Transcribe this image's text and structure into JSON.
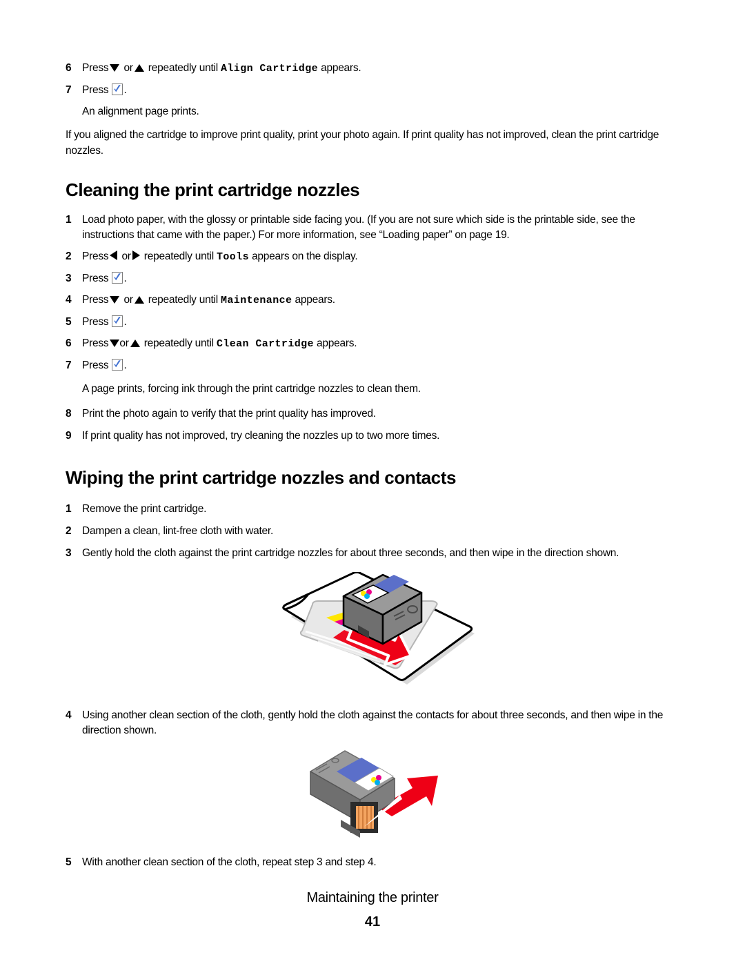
{
  "document": {
    "type": "printer-user-guide-page",
    "page_number": "41",
    "footer_title": "Maintaining the printer"
  },
  "top_steps": [
    {
      "num": "6",
      "pre": "Press",
      "icon_a": "triangle-down-icon",
      "mid": "or",
      "icon_b": "triangle-up-icon",
      "after": "repeatedly until",
      "mono": "Align Cartridge",
      "tail": "appears."
    },
    {
      "num": "7",
      "pre": "Press",
      "icon_a": "check-select-icon",
      "tail": "."
    }
  ],
  "top_result": "An alignment page prints.",
  "intro_paragraph": "If you aligned the cartridge to improve print quality, print your photo again. If print quality has not improved, clean the print cartridge nozzles.",
  "section_cleaning": {
    "heading": "Cleaning the print cartridge nozzles",
    "steps": [
      {
        "num": "1",
        "text": "Load photo paper, with the glossy or printable side facing you. (If you are not sure which side is the printable side, see the instructions that came with the paper.) For more information, see “Loading paper” on page 19."
      },
      {
        "num": "2",
        "pre": "Press",
        "icon_a": "triangle-left-icon",
        "mid": "or",
        "icon_b": "triangle-right-icon",
        "after": "repeatedly until",
        "mono": "Tools",
        "tail": "appears on the display."
      },
      {
        "num": "3",
        "pre": "Press",
        "icon_a": "check-select-icon",
        "tail": "."
      },
      {
        "num": "4",
        "pre": "Press",
        "icon_a": "triangle-down-icon",
        "mid": "or",
        "icon_b": "triangle-up-icon",
        "after": "repeatedly until",
        "mono": "Maintenance",
        "tail": "appears."
      },
      {
        "num": "5",
        "pre": "Press",
        "icon_a": "check-select-icon",
        "tail": "."
      },
      {
        "num": "6",
        "pre": "Press",
        "icon_a": "triangle-down-icon",
        "mid": "or",
        "icon_b": "triangle-up-icon",
        "after": "repeatedly until",
        "mono": "Clean Cartridge",
        "tail": "appears."
      },
      {
        "num": "7",
        "pre": "Press",
        "icon_a": "check-select-icon",
        "tail": "."
      }
    ],
    "result_text": "A page prints, forcing ink through the print cartridge nozzles to clean them.",
    "step8": {
      "num": "8",
      "text": "Print the photo again to verify that the print quality has improved."
    },
    "step9": {
      "num": "9",
      "text": "If print quality has not improved, try cleaning the nozzles up to two more times."
    }
  },
  "section_wiping": {
    "heading": "Wiping the print cartridge nozzles and contacts",
    "steps": [
      {
        "num": "1",
        "text": "Remove the print cartridge."
      },
      {
        "num": "2",
        "text": "Dampen a clean, lint-free cloth with water."
      },
      {
        "num": "3",
        "text": "Gently hold the cloth against the print cartridge nozzles for about three seconds, and then wipe in the direction shown."
      },
      {
        "num": "4",
        "text": "Using another clean section of the cloth, gently hold the cloth against the contacts for about three seconds, and then wipe in the direction shown."
      },
      {
        "num": "5",
        "text": "With another clean section of the cloth, repeat step 3 and step 4."
      }
    ]
  },
  "figures": [
    {
      "name": "cartridge-on-cloth-wipe-nozzles-illustration",
      "caption": "",
      "elements": [
        "lint-free cloth",
        "print cartridge",
        "ink smear yellow magenta cyan",
        "red direction arrow pointing down-right"
      ]
    },
    {
      "name": "cartridge-wipe-contacts-illustration",
      "caption": "",
      "elements": [
        "print cartridge",
        "copper contacts",
        "red direction arrow pointing up-right"
      ]
    }
  ],
  "colors": {
    "text": "#000000",
    "background": "#ffffff",
    "check_blue": "#3f6fd0",
    "arrow_red": "#ee0016",
    "cartridge_body": "#707070",
    "cartridge_label_blue": "#5b6fc9",
    "ink_yellow": "#ffe600",
    "ink_magenta": "#ec008c",
    "ink_cyan": "#00aeef",
    "contacts_copper": "#f4a460"
  }
}
